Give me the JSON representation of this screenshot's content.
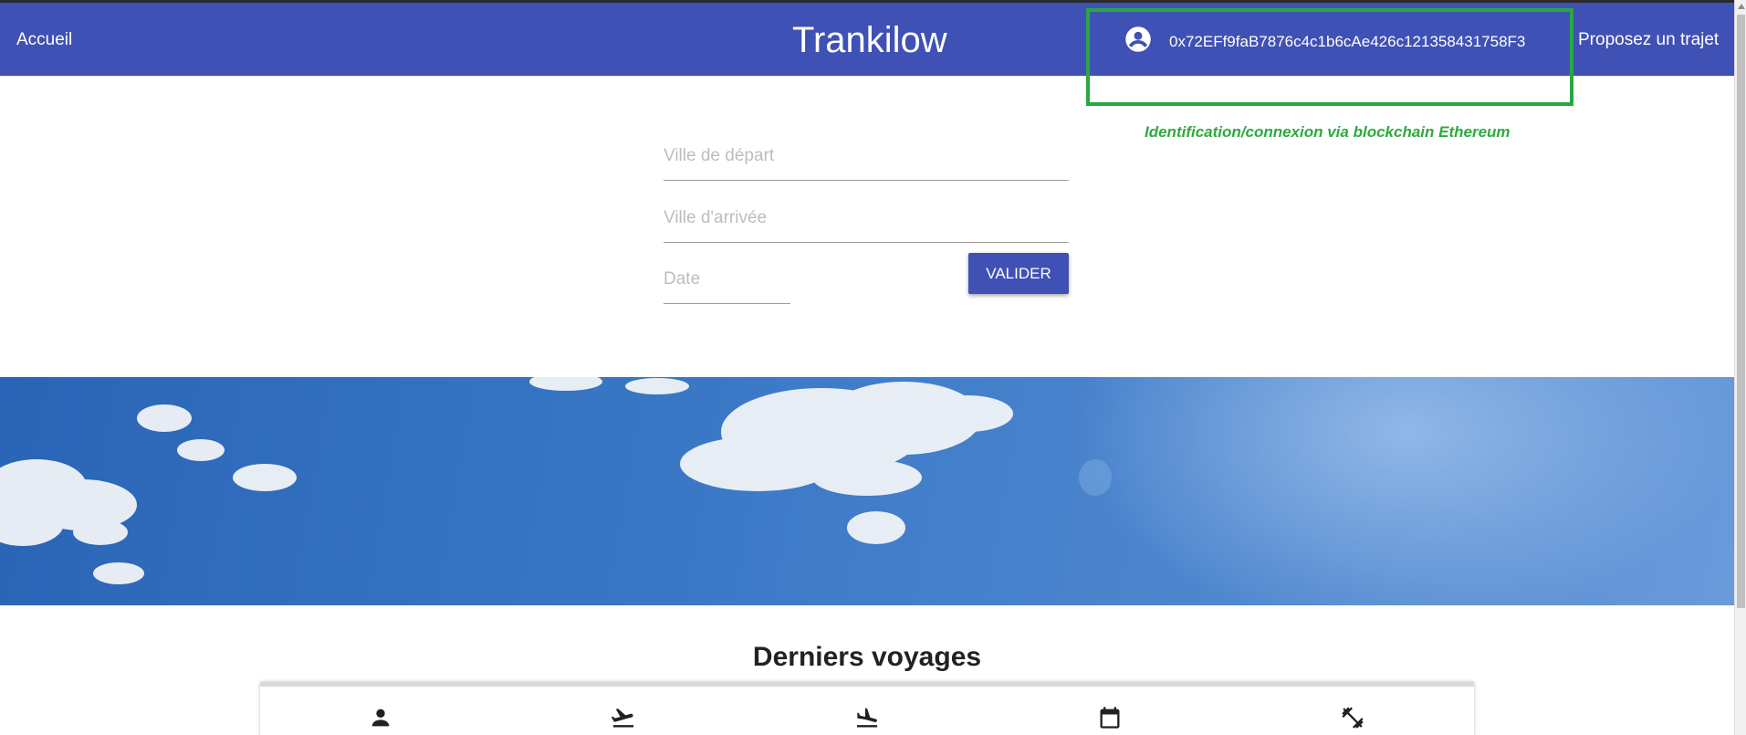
{
  "nav": {
    "home_label": "Accueil",
    "title": "Trankilow",
    "wallet_address": "0x72EFf9faB7876c4c1b6cAe426c121358431758F3",
    "propose_label": "Proposez un trajet",
    "account_icon": "account-circle-icon"
  },
  "annotation": {
    "text": "Identification/connexion via blockchain Ethereum",
    "color": "#28a745"
  },
  "search": {
    "departure_placeholder": "Ville de départ",
    "arrival_placeholder": "Ville d'arrivée",
    "date_placeholder": "Date",
    "submit_label": "VALIDER"
  },
  "recent": {
    "title": "Derniers voyages",
    "column_icons": [
      "person-icon",
      "flight-takeoff-icon",
      "flight-land-icon",
      "calendar-icon",
      "fitness-center-icon"
    ]
  },
  "colors": {
    "primary": "#3f51b5",
    "banner_sky": "#3a78c6"
  }
}
